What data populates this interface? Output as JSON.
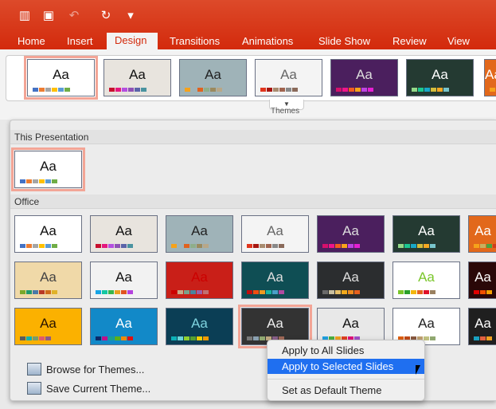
{
  "qat": [
    {
      "icon": "slides-icon",
      "glyph": "▥"
    },
    {
      "icon": "save-icon",
      "glyph": "▣"
    },
    {
      "icon": "undo-icon",
      "glyph": "↶"
    },
    {
      "icon": "redo-icon",
      "glyph": "↻"
    },
    {
      "icon": "customize-icon",
      "glyph": "▾"
    }
  ],
  "tabs": [
    "Home",
    "Insert",
    "Design",
    "Transitions",
    "Animations",
    "Slide Show",
    "Review",
    "View"
  ],
  "active_tab": "Design",
  "gallery": {
    "themes_label": "Themes"
  },
  "panel": {
    "this_presentation": "This Presentation",
    "office": "Office",
    "browse": "Browse for Themes...",
    "save": "Save Current Theme..."
  },
  "theme_sample": "Aa",
  "themes": [
    {
      "bg": "#ffffff",
      "fg": "#111",
      "sw": [
        "#4472c4",
        "#ed7d31",
        "#a5a5a5",
        "#ffc000",
        "#5b9bd5",
        "#70ad47"
      ]
    },
    {
      "bg": "#e8e4de",
      "fg": "#111",
      "sw": [
        "#c8102e",
        "#e5177e",
        "#b44fe0",
        "#8e51b5",
        "#5b64a9",
        "#4a93a0"
      ]
    },
    {
      "bg": "#9fb3b8",
      "fg": "#222",
      "sw": [
        "#f6a21a",
        "#9fb3b8",
        "#e0621e",
        "#8fae8a",
        "#9b8a5e",
        "#b8a788"
      ]
    },
    {
      "bg": "#f4f4f4",
      "fg": "#666",
      "sw": [
        "#e0351d",
        "#a7160f",
        "#a88c70",
        "#a0644f",
        "#888",
        "#8a6a5a"
      ]
    },
    {
      "bg": "#4b1f5e",
      "fg": "#ddd",
      "sw": [
        "#d6106c",
        "#f0148a",
        "#f35c1f",
        "#f8a31a",
        "#bd44e2",
        "#e61fd3"
      ]
    },
    {
      "bg": "#243a32",
      "fg": "#fff",
      "sw": [
        "#93d888",
        "#1cc790",
        "#19a8c8",
        "#d5bd3c",
        "#f6a823",
        "#78c5cc"
      ]
    },
    {
      "bg": "#e2681b",
      "fg": "#fff",
      "sw": [
        "#f6a21a",
        "#c6b05e",
        "#4aa33e",
        "#d03c1c"
      ]
    },
    {
      "bg": "#f0d9a8",
      "fg": "#444",
      "sw": [
        "#7aa82a",
        "#1f9a6c",
        "#4a79a8",
        "#b83826",
        "#cf6a1a",
        "#e0b228"
      ]
    },
    {
      "bg": "#f2f2f2",
      "fg": "#111",
      "sw": [
        "#17a4e6",
        "#15c7a3",
        "#39b54a",
        "#eba021",
        "#e05320",
        "#b442de"
      ]
    },
    {
      "bg": "#c91f18",
      "fg": "#c00",
      "sw": [
        "#c00",
        "#c8a888",
        "#7aa08a",
        "#4a84a0",
        "#9a60a8",
        "#c07070"
      ]
    },
    {
      "bg": "#0f4e54",
      "fg": "#ddd",
      "sw": [
        "#c00d0d",
        "#f04d10",
        "#ee9920",
        "#19b4a0",
        "#4aa0c8",
        "#b04aa0"
      ]
    },
    {
      "bg": "#2b2d2f",
      "fg": "#ddd",
      "sw": [
        "#6a6a6a",
        "#c9bfa0",
        "#e6c06a",
        "#f2a91c",
        "#ee8a1e",
        "#e6601e"
      ]
    },
    {
      "bg": "#ffffff",
      "fg": "#7ac62a",
      "sw": [
        "#7ac62a",
        "#2ba02a",
        "#f2b60e",
        "#e5621e",
        "#e0102a",
        "#9a8060"
      ]
    },
    {
      "bg": "#2a0808",
      "fg": "#fff",
      "sw": [
        "#e00000",
        "#f05000",
        "#f5a000"
      ]
    },
    {
      "bg": "#fbb100",
      "fg": "#2a1400",
      "sw": [
        "#5b5b5b",
        "#0fb0b0",
        "#7a9a6a",
        "#e05a6a",
        "#8a5a8a"
      ]
    },
    {
      "bg": "#1289c8",
      "fg": "#fff",
      "sw": [
        "#0a2a6a",
        "#c0108a",
        "#18a090",
        "#5ab01a",
        "#f08a00",
        "#e01010"
      ]
    },
    {
      "bg": "#0b3e55",
      "fg": "#7fd4e0",
      "sw": [
        "#0db0b8",
        "#6ad4d8",
        "#8ed030",
        "#55a030",
        "#f0d000",
        "#f09a00"
      ]
    },
    {
      "bg": "#333333",
      "fg": "#eee",
      "sw": [
        "#777",
        "#8aa0b0",
        "#90a870",
        "#c0a880",
        "#8a608a",
        "#a06a58"
      ]
    },
    {
      "bg": "#e8e8e8",
      "fg": "#111",
      "sw": [
        "#1fa0e0",
        "#4ab040",
        "#f0a020",
        "#e04020",
        "#e0107a",
        "#a050c8"
      ]
    },
    {
      "bg": "#ffffff",
      "fg": "#222",
      "sw": [
        "#e06010",
        "#c04a18",
        "#8a5a40",
        "#c0a070",
        "#c0c080",
        "#90a870"
      ]
    },
    {
      "bg": "#1f1f1f",
      "fg": "#fff",
      "sw": [
        "#18a0c0",
        "#e06040",
        "#f0a020"
      ]
    }
  ],
  "context_menu": {
    "items": [
      "Apply to All Slides",
      "Apply to Selected Slides",
      "Set as Default Theme"
    ],
    "highlighted": "Apply to Selected Slides"
  },
  "colors": {
    "accent": "#d32a0c",
    "highlight": "#1f6ff0",
    "selection": "#f3a596"
  }
}
